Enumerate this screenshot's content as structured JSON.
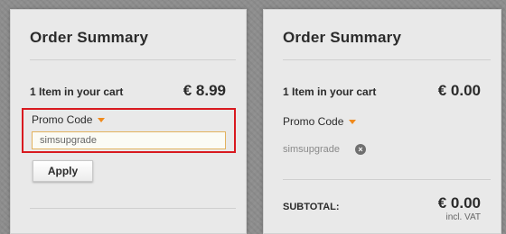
{
  "left_panel": {
    "title": "Order Summary",
    "items_label": "1 Item in your cart",
    "price": "€ 8.99",
    "promo": {
      "label": "Promo Code",
      "input_value": "simsupgrade",
      "apply_label": "Apply"
    }
  },
  "right_panel": {
    "title": "Order Summary",
    "items_label": "1 Item in your cart",
    "price": "€ 0.00",
    "promo": {
      "label": "Promo Code",
      "applied_code": "simsupgrade",
      "remove_symbol": "×"
    },
    "subtotal": {
      "label": "SUBTOTAL:",
      "price": "€ 0.00",
      "vat_note": "incl. VAT"
    }
  },
  "colors": {
    "accent_caret": "#f08a1c",
    "highlight_border": "#d8191f"
  }
}
